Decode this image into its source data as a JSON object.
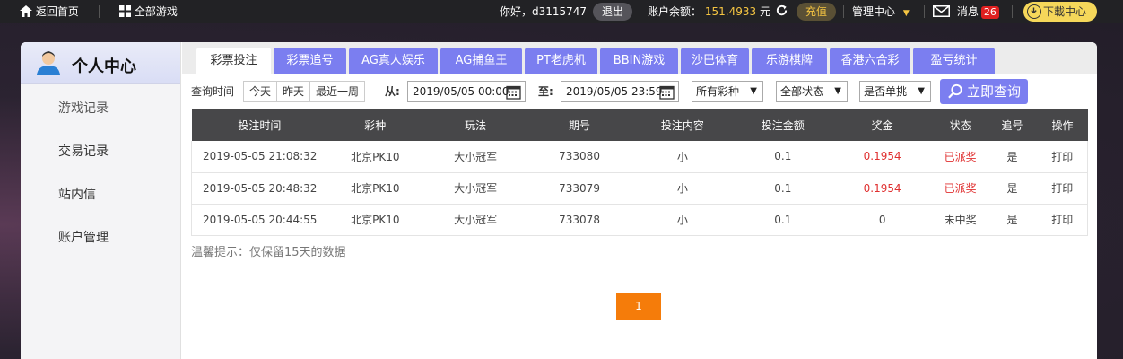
{
  "topbar": {
    "home_label": "返回首页",
    "all_games_label": "全部游戏",
    "greeting": "你好，d3115747",
    "logout_label": "退出",
    "balance_label": "账户余额：",
    "balance_value": "151.4933",
    "balance_unit": "元",
    "recharge_label": "充值",
    "manage_label": "管理中心",
    "messages_label": "消息",
    "messages_count": "26",
    "download_label": "下載中心"
  },
  "sidebar": {
    "title": "个人中心",
    "items": [
      {
        "label": "游戏记录"
      },
      {
        "label": "交易记录"
      },
      {
        "label": "站内信"
      },
      {
        "label": "账户管理"
      }
    ]
  },
  "tabs": [
    {
      "label": "彩票投注"
    },
    {
      "label": "彩票追号"
    },
    {
      "label": "AG真人娱乐"
    },
    {
      "label": "AG捕鱼王"
    },
    {
      "label": "PT老虎机"
    },
    {
      "label": "BBIN游戏"
    },
    {
      "label": "沙巴体育"
    },
    {
      "label": "乐游棋牌"
    },
    {
      "label": "香港六合彩"
    },
    {
      "label": "盈亏统计"
    }
  ],
  "filter": {
    "query_time_label": "查询时间",
    "quick": [
      "今天",
      "昨天",
      "最近一周"
    ],
    "from_label": "从:",
    "from_value": "2019/05/05 00:00",
    "to_label": "至:",
    "to_value": "2019/05/05 23:59",
    "lottery_select": "所有彩种",
    "status_select": "全部状态",
    "single_select": "是否单挑",
    "query_button": "立即查询"
  },
  "table": {
    "headers": [
      "投注时间",
      "彩种",
      "玩法",
      "期号",
      "投注内容",
      "投注金额",
      "奖金",
      "状态",
      "追号",
      "操作"
    ],
    "rows": [
      [
        "2019-05-05 21:08:32",
        "北京PK10",
        "大小冠军",
        "733080",
        "小",
        "0.1",
        "0.1954",
        "已派奖",
        "是",
        "打印"
      ],
      [
        "2019-05-05 20:48:32",
        "北京PK10",
        "大小冠军",
        "733079",
        "小",
        "0.1",
        "0.1954",
        "已派奖",
        "是",
        "打印"
      ],
      [
        "2019-05-05 20:44:55",
        "北京PK10",
        "大小冠军",
        "733078",
        "小",
        "0.1",
        "0",
        "未中奖",
        "是",
        "打印"
      ]
    ]
  },
  "hint": "温馨提示：仅保留15天的数据",
  "pager": {
    "current": "1"
  },
  "colors": {
    "accent": "#7b7ef0",
    "win": "#e03030",
    "pager": "#f57c0a"
  }
}
